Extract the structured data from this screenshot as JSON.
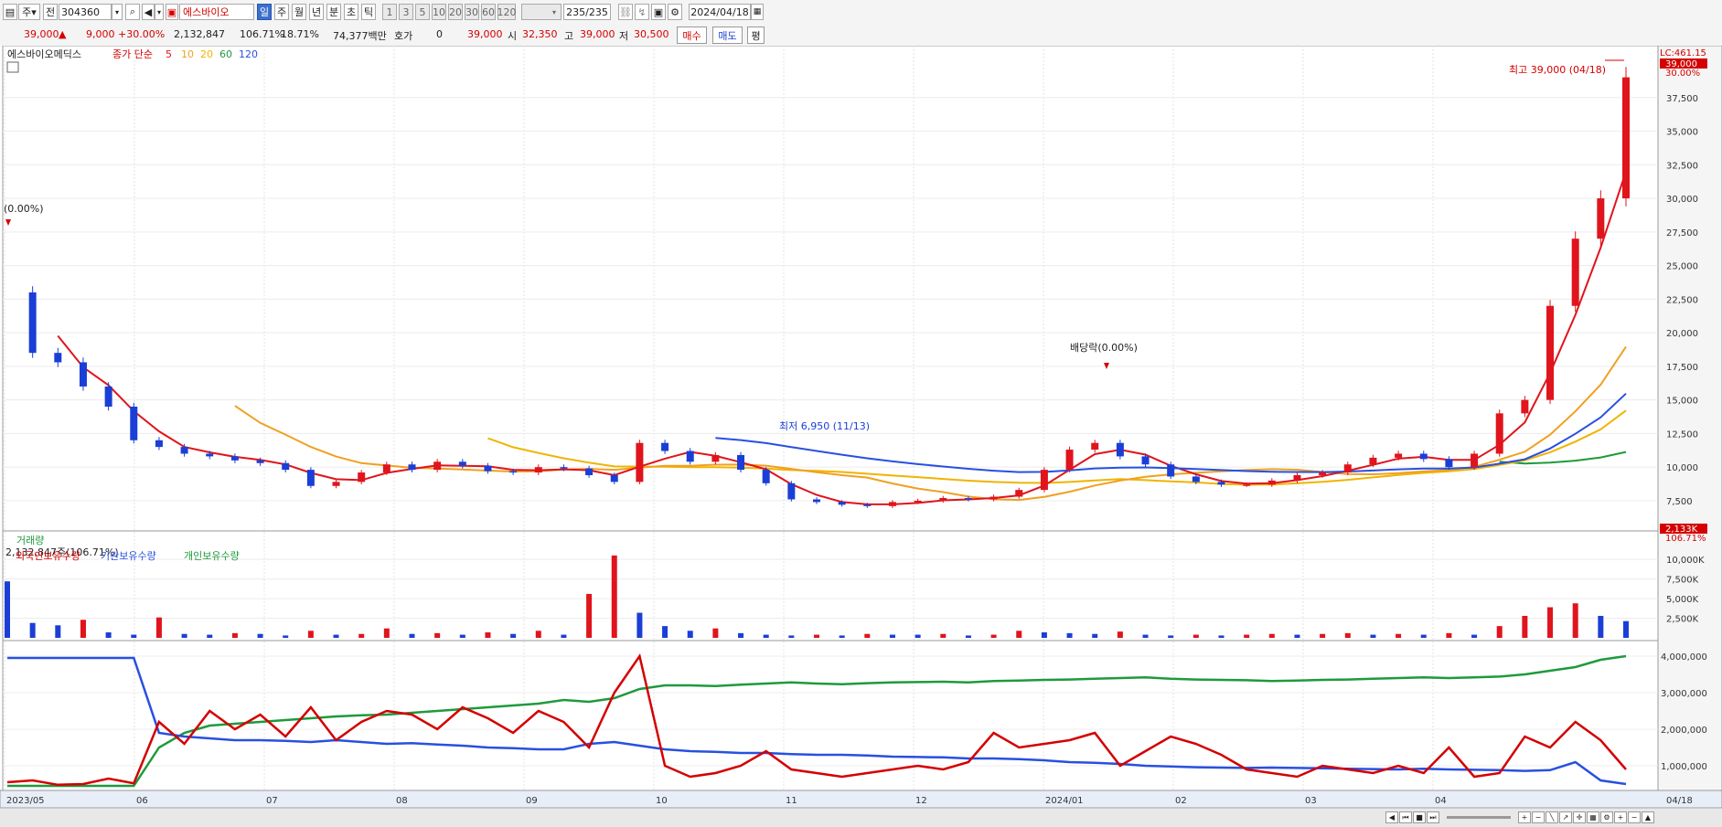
{
  "toolbar": {
    "period": "주",
    "type": "전",
    "code": "304360",
    "stock_name": "에스바이오",
    "interval_tabs": [
      "일",
      "주",
      "월",
      "년",
      "분",
      "초",
      "틱"
    ],
    "selected_tab": "일",
    "minute_buttons": [
      "1",
      "3",
      "5",
      "10",
      "20",
      "30",
      "60",
      "120"
    ],
    "count": "235/235",
    "date": "2024/04/18"
  },
  "info": {
    "price": "39,000",
    "change": "9,000",
    "change_pct": "+30.00%",
    "volume": "2,132,847",
    "vol_ratio": "106.71%",
    "turnover": "18.71%",
    "amount": "74,377백만",
    "hoga_label": "호가",
    "hoga_value": "0",
    "cur_price": "39,000",
    "open_label": "시",
    "open": "32,350",
    "high_label": "고",
    "high": "39,000",
    "low_label": "저",
    "low": "30,500",
    "buy": "매수",
    "sell": "매도",
    "eval": "평"
  },
  "price_panel": {
    "name": "에스바이오메딕스",
    "ma_label": "종가 단순",
    "ma_periods": [
      "5",
      "10",
      "20",
      "60",
      "120"
    ],
    "ma_colors": [
      "#e0141c",
      "#f0a020",
      "#f0b400",
      "#1e9a3c",
      "#2850e0"
    ],
    "lc_label": "LC:461.15",
    "last_price_tag": "39,000",
    "last_pct_tag": "30.00%",
    "high_note": "최고 39,000 (04/18)",
    "low_note": "최저 6,950 (11/13)",
    "left_note": "(0.00%)",
    "div_note": "배당락(0.00%)",
    "yticks": [
      "37,500",
      "35,000",
      "32,500",
      "30,000",
      "27,500",
      "25,000",
      "22,500",
      "20,000",
      "17,500",
      "15,000",
      "12,500",
      "10,000",
      "7,500"
    ]
  },
  "volume_panel": {
    "name": "거래량",
    "info": "2,132,847주(106.71%)",
    "yticks": [
      "10,000K",
      "7,500K",
      "5,000K",
      "2,500K"
    ],
    "last_tag": "2,133K",
    "last_pct": "106.71%"
  },
  "holding_panel": {
    "legend": [
      "외국인보유수량",
      "기관보유수량",
      "개인보유수량"
    ],
    "legend_colors": [
      "#d40000",
      "#2850e0",
      "#1e9a3c"
    ],
    "yticks": [
      "4,000,000",
      "3,000,000",
      "2,000,000",
      "1,000,000"
    ]
  },
  "xaxis": [
    "2023/05",
    "06",
    "07",
    "08",
    "09",
    "10",
    "11",
    "12",
    "2024/01",
    "02",
    "03",
    "04"
  ],
  "xaxis_right": "04/18",
  "chart_data": {
    "type": "line",
    "series": [
      {
        "name": "종가",
        "values": [
          23000,
          18500,
          17800,
          16000,
          14500,
          12000,
          11500,
          11000,
          10800,
          10500,
          10300,
          9800,
          8600,
          8900,
          9600,
          10200,
          9800,
          10400,
          10100,
          9700,
          9600,
          10000,
          9900,
          9400,
          8900,
          11800,
          11200,
          10400,
          10900,
          9800,
          8800,
          7600,
          7400,
          7200,
          7100,
          7400,
          7500,
          7700,
          7600,
          7800,
          8300,
          9800,
          11300,
          11800,
          10800,
          10200,
          9300,
          8900,
          8700,
          8700,
          9000,
          9400,
          9600,
          10200,
          10700,
          11000,
          10600,
          10000,
          11000,
          14000,
          15000,
          22000,
          27000,
          30000,
          39000
        ]
      },
      {
        "name": "외국인보유수량",
        "values": [
          550000,
          600000,
          480000,
          500000,
          650000,
          520000,
          2200000,
          1600000,
          2500000,
          2000000,
          2400000,
          1800000,
          2600000,
          1700000,
          2200000,
          2500000,
          2400000,
          2000000,
          2600000,
          2300000,
          1900000,
          2500000,
          2200000,
          1500000,
          3000000,
          4000000,
          1000000,
          700000,
          800000,
          1000000,
          1400000,
          900000,
          800000,
          700000,
          800000,
          900000,
          1000000,
          900000,
          1100000,
          1900000,
          1500000,
          1600000,
          1700000,
          1900000,
          1000000,
          1400000,
          1800000,
          1600000,
          1300000,
          900000,
          800000,
          700000,
          1000000,
          900000,
          800000,
          1000000,
          800000,
          1500000,
          700000,
          800000,
          1800000,
          1500000,
          2200000,
          1700000,
          900000
        ]
      },
      {
        "name": "기관보유수량",
        "values": [
          3950000,
          3950000,
          3950000,
          3950000,
          3950000,
          3950000,
          1900000,
          1800000,
          1750000,
          1700000,
          1700000,
          1680000,
          1650000,
          1700000,
          1650000,
          1600000,
          1620000,
          1580000,
          1550000,
          1500000,
          1480000,
          1450000,
          1450000,
          1600000,
          1650000,
          1550000,
          1450000,
          1400000,
          1380000,
          1350000,
          1350000,
          1320000,
          1300000,
          1300000,
          1280000,
          1250000,
          1240000,
          1230000,
          1200000,
          1200000,
          1180000,
          1150000,
          1100000,
          1080000,
          1050000,
          1000000,
          980000,
          960000,
          950000,
          940000,
          950000,
          940000,
          930000,
          920000,
          910000,
          900000,
          920000,
          900000,
          890000,
          880000,
          860000,
          880000,
          1100000,
          600000,
          500000
        ]
      },
      {
        "name": "개인보유수량",
        "values": [
          450000,
          450000,
          450000,
          450000,
          450000,
          450000,
          1500000,
          1900000,
          2100000,
          2150000,
          2200000,
          2250000,
          2300000,
          2350000,
          2380000,
          2400000,
          2450000,
          2500000,
          2550000,
          2600000,
          2650000,
          2700000,
          2800000,
          2750000,
          2850000,
          3100000,
          3200000,
          3200000,
          3180000,
          3220000,
          3250000,
          3280000,
          3250000,
          3230000,
          3260000,
          3280000,
          3290000,
          3300000,
          3280000,
          3320000,
          3330000,
          3350000,
          3360000,
          3380000,
          3400000,
          3420000,
          3380000,
          3360000,
          3350000,
          3340000,
          3320000,
          3330000,
          3350000,
          3360000,
          3380000,
          3400000,
          3420000,
          3400000,
          3420000,
          3440000,
          3500000,
          3600000,
          3700000,
          3900000,
          4000000
        ]
      }
    ],
    "ylim_price": [
      6000,
      40000
    ],
    "ylim_holding": [
      500000,
      4200000
    ]
  }
}
